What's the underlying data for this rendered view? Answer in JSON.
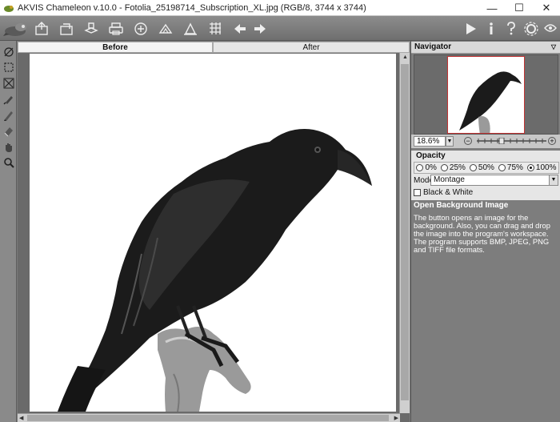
{
  "window": {
    "title": "AKVIS Chameleon v.10.0 - Fotolia_25198714_Subscription_XL.jpg (RGB/8, 3744 x 3744)",
    "controls": {
      "minimize": "—",
      "maximize": "☐",
      "close": "✕"
    }
  },
  "toolbar": {
    "left_icons": [
      "logo-icon",
      "open-icon",
      "export-icon",
      "open-background-icon",
      "print-icon",
      "share-icon",
      "copy-icon",
      "batch-icon",
      "grid-icon",
      "undo-icon",
      "redo-icon"
    ],
    "right_icons": [
      "run-icon",
      "info-icon",
      "help-icon",
      "settings-icon",
      "news-icon"
    ]
  },
  "left_tools": [
    "navigator-tool-icon",
    "selection-icon",
    "transform-icon",
    "brush-icon",
    "pencil-icon",
    "eraser-icon",
    "hand-icon",
    "zoom-icon"
  ],
  "tabs": {
    "before": "Before",
    "after": "After"
  },
  "navigator": {
    "title": "Navigator",
    "zoom_value": "18.6%",
    "zoom_minus": "⊖",
    "zoom_plus": "⊕"
  },
  "opacity": {
    "label": "Opacity",
    "options": [
      "0%",
      "25%",
      "50%",
      "75%",
      "100%"
    ],
    "selected": "100%"
  },
  "mode": {
    "label": "Mode",
    "value": "Montage"
  },
  "black_white": {
    "label": "Black & White",
    "checked": false
  },
  "help": {
    "title": "Open Background Image",
    "text": "The button opens an image for the background. Also, you can drag and drop the image into the program's workspace. The program supports BMP, JPEG, PNG and TIFF file formats."
  },
  "colors": {
    "toolbar": "#7b7b7b",
    "panel": "#7d7d7d",
    "nav_frame": "#c23232"
  }
}
